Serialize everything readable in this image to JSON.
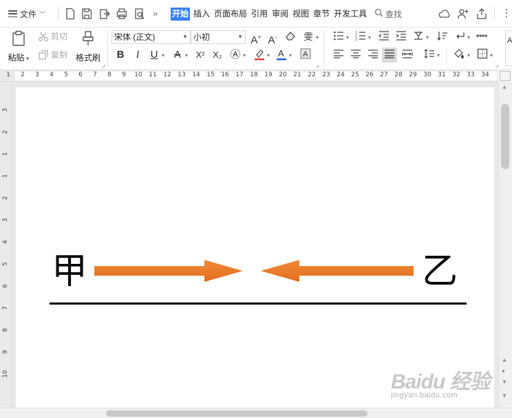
{
  "app": {
    "file_menu_label": "文件",
    "tabs": [
      "开始",
      "插入",
      "页面布局",
      "引用",
      "审阅",
      "视图",
      "章节",
      "开发工具"
    ],
    "active_tab": "开始",
    "search_label": "查找",
    "accent_color": "#3b82f6"
  },
  "ribbon": {
    "paste_label": "粘贴",
    "cut_label": "剪切",
    "copy_label": "复制",
    "format_painter_label": "格式刷",
    "font_name": "宋体 (正文)",
    "font_size": "小初",
    "bold": "B",
    "italic": "I",
    "underline": "U",
    "superscript": "X²",
    "subscript": "X₂",
    "style_preview": "A"
  },
  "ruler": {
    "horizontal_ticks": [
      "1",
      "2",
      "3",
      "4",
      "5",
      "6",
      "7",
      "8",
      "9",
      "10",
      "11",
      "12",
      "13",
      "14",
      "15",
      "16",
      "17",
      "18",
      "19",
      "20",
      "21",
      "22",
      "23",
      "24",
      "25",
      "26",
      "27",
      "28",
      "29",
      "30",
      "31",
      "32",
      "33",
      "34"
    ],
    "vertical_ticks": [
      "3",
      "2",
      "1",
      "1",
      "2",
      "3",
      "4",
      "5",
      "6",
      "7",
      "8",
      "9",
      "10"
    ]
  },
  "document": {
    "left_char": "甲",
    "right_char": "乙",
    "arrow_color": "#ee7d2a",
    "line_color": "#000000"
  },
  "watermark": {
    "brand": "Baidu 经验",
    "site": "jingyan.baidu.com"
  }
}
